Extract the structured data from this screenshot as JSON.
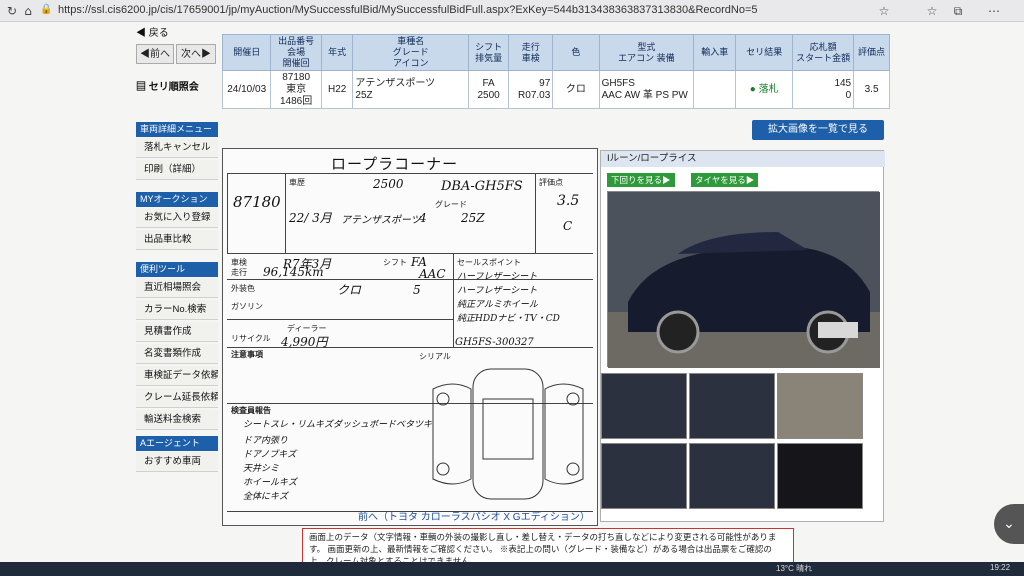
{
  "browser": {
    "url": "https://ssl.cis6200.jp/cis/17659001/jp/myAuction/MySuccessfulBid/MySuccessfulBidFull.aspx?ExKey=544b313438363837313830&RecordNo=5"
  },
  "sidebar": {
    "back_label": "戻る",
    "prev_label": "◀前へ",
    "next_label": "次へ▶",
    "auction_ref_label": "セリ順照会",
    "sections": [
      {
        "head": "車両詳細メニュー",
        "items": [
          "落札キャンセル",
          "印刷（詳細）"
        ]
      },
      {
        "head": "MYオークション",
        "items": [
          "お気に入り登録",
          "出品車比較"
        ]
      },
      {
        "head": "便利ツール",
        "items": [
          "直近相場照会",
          "カラーNo.検索",
          "見積書作成",
          "名変書類作成",
          "車検証データ依頼",
          "クレーム延長依頼",
          "輸送料金検索"
        ]
      },
      {
        "head": "Aエージェント",
        "items": [
          "おすすめ車両"
        ]
      }
    ]
  },
  "table": {
    "headers": [
      "開催日",
      "出品番号\n会場\n開催回",
      "年式",
      "車種名\nグレード\nアイコン",
      "シフト\n排気量",
      "走行\n車検",
      "色",
      "型式\nエアコン 装備",
      "輸入車",
      "セリ結果",
      "応札額\nスタート金額",
      "評価点"
    ],
    "row": [
      "24/10/03",
      "87180\n東京\n1486回",
      "H22",
      "アテンザスポーツ\n25Z",
      "FA\n2500",
      "97\nR07.03",
      "クロ",
      "GH5FS\nAAC AW 革 PS PW",
      "",
      "● 落札",
      "145\n0",
      "3.5"
    ]
  },
  "enlarge_button": "拡大画像を一覧で見る",
  "sheet": {
    "title": "ロープラコーナー",
    "lot": "87180",
    "model_code": "DBA-GH5FS",
    "displacement": "2500",
    "year": "22/ 3月",
    "name": "アテンザスポーツ",
    "doors": "4",
    "grade": "25Z",
    "score": "3.5",
    "interior": "C",
    "inspection": "R7年3月",
    "mileage": "96,145km",
    "shift": "FA",
    "ac": "AAC",
    "fuel": "ガソリン",
    "color": "クロ",
    "seats": "5",
    "recycle": "4,990円",
    "chassis": "GH5FS-300327",
    "sales_points": [
      "セールスポイント",
      "ハーフレザーシート",
      "ハーフレザーシート",
      "純正アルミホイール",
      "純正HDDナビ・TV・CD"
    ],
    "notes_head": "注意事項",
    "report_head": "検査員報告",
    "report_lines": [
      "シートスレ・リムキズ",
      "ダッシュボードベタツキ",
      "ドア内張り",
      "ドアノブキズ",
      "天井シミ",
      "ホイールキズ",
      "全体にキズ"
    ],
    "labels": {
      "cartype": "車歴",
      "grade": "グレード",
      "inspection": "車検",
      "mileage": "走行",
      "shift": "シフト",
      "color": "外装色",
      "recycle": "リサイクル",
      "chassis": "シリアル",
      "dealer": "ディーラー",
      "score_lbl": "評価点"
    }
  },
  "photos": {
    "head": "Iルーン/ロープライス",
    "btn_below": "下回りを見る▶",
    "btn_tires": "タイヤを見る▶"
  },
  "prev_link": "前へ（トヨタ カローラスパシオ X Gエディション）",
  "notice": "画面上のデータ（文字情報・車輌の外装の撮影し直し・差し替え・データの打ち直しなどにより変更される可能性があります。 画面更新の上、最新情報をご確認ください。 ※表記上の問い（グレード・装備など）がある場合は出品票をご確認の上、クレーム対象とすることはできません。",
  "taskbar": {
    "weather": "13°C 晴れ",
    "time": "19:22"
  },
  "colors": {
    "accent": "#1d5fa8",
    "header_bg": "#c9d9ec",
    "green_btn": "#2e9a3a"
  }
}
